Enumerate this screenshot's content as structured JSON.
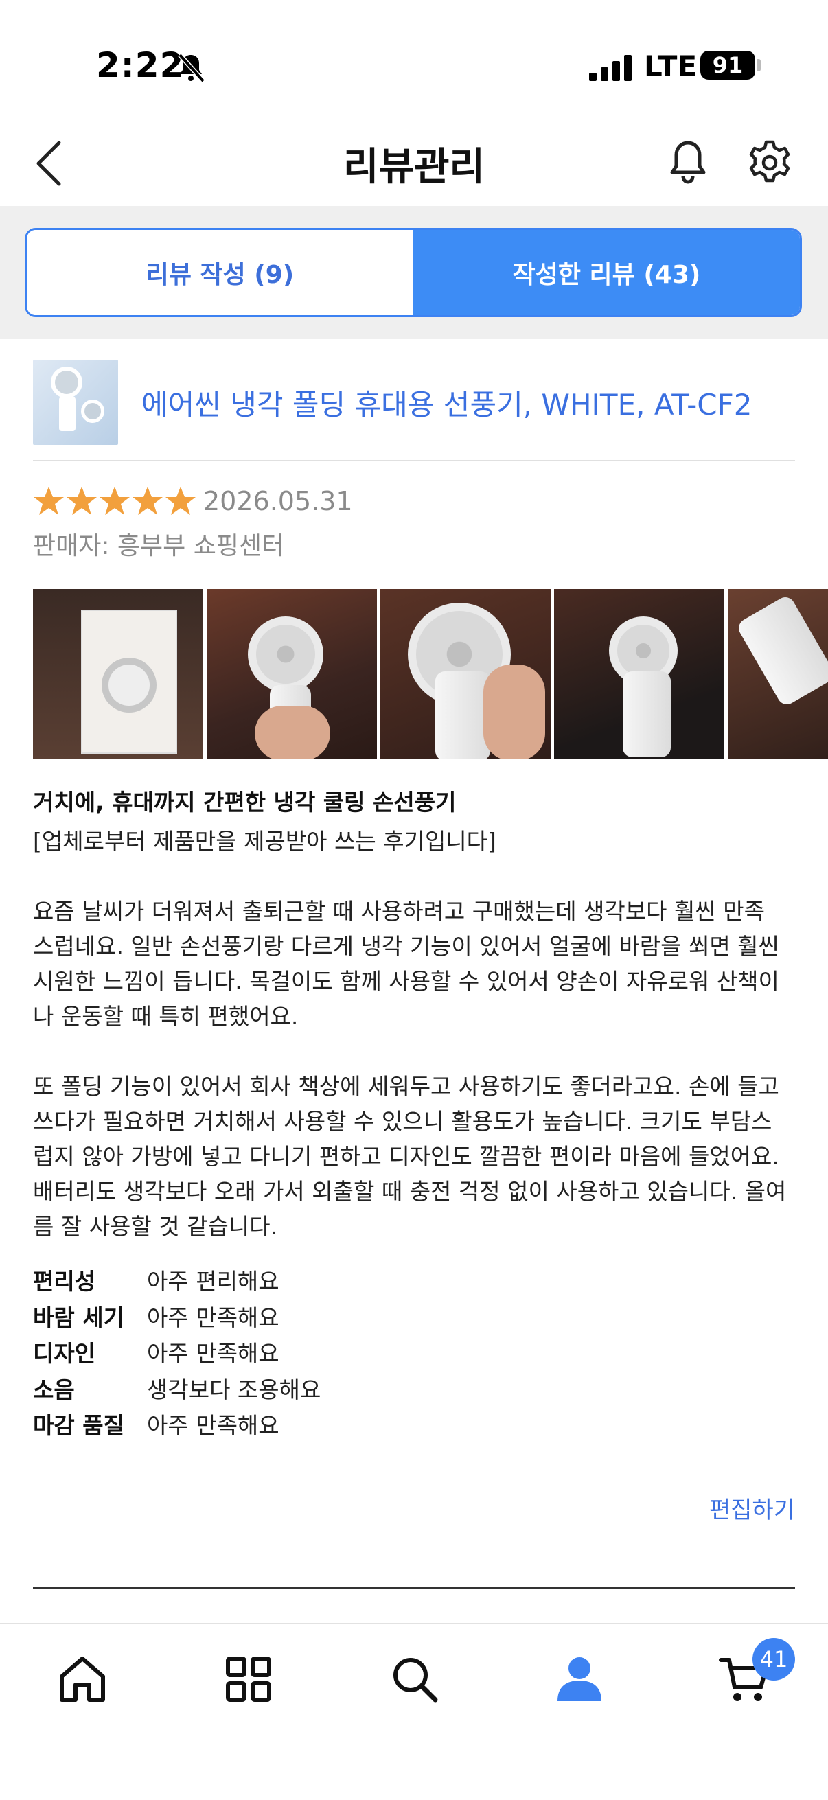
{
  "status_bar": {
    "time": "2:22",
    "network": "LTE",
    "battery": "91"
  },
  "header": {
    "title": "리뷰관리"
  },
  "tabs": [
    {
      "label": "리뷰 작성 (9)",
      "active": false
    },
    {
      "label": "작성한 리뷰 (43)",
      "active": true
    }
  ],
  "review": {
    "product_name": "에어씬 냉각 폴딩 휴대용 선풍기, WHITE, AT-CF2",
    "rating": 5,
    "date": "2026.05.31",
    "seller": "판매자: 흥부부 쇼핑센터",
    "title": "거치에, 휴대까지 간편한 냉각 쿨링 손선풍기",
    "body": "[업체로부터 제품만을 제공받아 쓰는 후기입니다]\n\n요즘 날씨가 더워져서 출퇴근할 때 사용하려고 구매했는데 생각보다 훨씬 만족\n스럽네요. 일반 손선풍기랑 다르게 냉각 기능이 있어서 얼굴에 바람을 쐬면 훨씬\n시원한 느낌이 듭니다. 목걸이도 함께 사용할 수 있어서 양손이 자유로워 산책이\n나 운동할 때 특히 편했어요.\n\n또 폴딩 기능이 있어서 회사 책상에 세워두고 사용하기도 좋더라고요. 손에 들고\n쓰다가 필요하면 거치해서 사용할 수 있으니 활용도가 높습니다. 크기도 부담스\n럽지 않아 가방에 넣고 다니기 편하고 디자인도 깔끔한 편이라 마음에 들었어요.\n배터리도 생각보다 오래 가서 외출할 때 충전 걱정 없이 사용하고 있습니다. 올여\n름 잘 사용할 것 같습니다.",
    "attributes": [
      {
        "key": "편리성",
        "value": "아주 편리해요"
      },
      {
        "key": "바람 세기",
        "value": "아주 만족해요"
      },
      {
        "key": "디자인",
        "value": "아주 만족해요"
      },
      {
        "key": "소음",
        "value": "생각보다 조용해요"
      },
      {
        "key": "마감 품질",
        "value": "아주 만족해요"
      }
    ],
    "edit_label": "편집하기"
  },
  "bottom_nav": {
    "items": [
      "home-icon",
      "category-grid-icon",
      "search-icon",
      "my-account-icon",
      "cart-icon"
    ],
    "cart_count": "41"
  },
  "colors": {
    "accent": "#3d82f2",
    "link": "#3a6fe0",
    "star": "#f2a03d"
  }
}
